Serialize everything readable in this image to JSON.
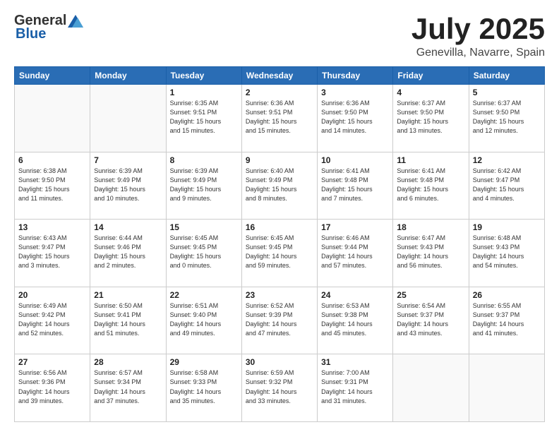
{
  "header": {
    "logo_general": "General",
    "logo_blue": "Blue",
    "month": "July 2025",
    "location": "Genevilla, Navarre, Spain"
  },
  "weekdays": [
    "Sunday",
    "Monday",
    "Tuesday",
    "Wednesday",
    "Thursday",
    "Friday",
    "Saturday"
  ],
  "weeks": [
    [
      {
        "day": "",
        "info": ""
      },
      {
        "day": "",
        "info": ""
      },
      {
        "day": "1",
        "info": "Sunrise: 6:35 AM\nSunset: 9:51 PM\nDaylight: 15 hours\nand 15 minutes."
      },
      {
        "day": "2",
        "info": "Sunrise: 6:36 AM\nSunset: 9:51 PM\nDaylight: 15 hours\nand 15 minutes."
      },
      {
        "day": "3",
        "info": "Sunrise: 6:36 AM\nSunset: 9:50 PM\nDaylight: 15 hours\nand 14 minutes."
      },
      {
        "day": "4",
        "info": "Sunrise: 6:37 AM\nSunset: 9:50 PM\nDaylight: 15 hours\nand 13 minutes."
      },
      {
        "day": "5",
        "info": "Sunrise: 6:37 AM\nSunset: 9:50 PM\nDaylight: 15 hours\nand 12 minutes."
      }
    ],
    [
      {
        "day": "6",
        "info": "Sunrise: 6:38 AM\nSunset: 9:50 PM\nDaylight: 15 hours\nand 11 minutes."
      },
      {
        "day": "7",
        "info": "Sunrise: 6:39 AM\nSunset: 9:49 PM\nDaylight: 15 hours\nand 10 minutes."
      },
      {
        "day": "8",
        "info": "Sunrise: 6:39 AM\nSunset: 9:49 PM\nDaylight: 15 hours\nand 9 minutes."
      },
      {
        "day": "9",
        "info": "Sunrise: 6:40 AM\nSunset: 9:49 PM\nDaylight: 15 hours\nand 8 minutes."
      },
      {
        "day": "10",
        "info": "Sunrise: 6:41 AM\nSunset: 9:48 PM\nDaylight: 15 hours\nand 7 minutes."
      },
      {
        "day": "11",
        "info": "Sunrise: 6:41 AM\nSunset: 9:48 PM\nDaylight: 15 hours\nand 6 minutes."
      },
      {
        "day": "12",
        "info": "Sunrise: 6:42 AM\nSunset: 9:47 PM\nDaylight: 15 hours\nand 4 minutes."
      }
    ],
    [
      {
        "day": "13",
        "info": "Sunrise: 6:43 AM\nSunset: 9:47 PM\nDaylight: 15 hours\nand 3 minutes."
      },
      {
        "day": "14",
        "info": "Sunrise: 6:44 AM\nSunset: 9:46 PM\nDaylight: 15 hours\nand 2 minutes."
      },
      {
        "day": "15",
        "info": "Sunrise: 6:45 AM\nSunset: 9:45 PM\nDaylight: 15 hours\nand 0 minutes."
      },
      {
        "day": "16",
        "info": "Sunrise: 6:45 AM\nSunset: 9:45 PM\nDaylight: 14 hours\nand 59 minutes."
      },
      {
        "day": "17",
        "info": "Sunrise: 6:46 AM\nSunset: 9:44 PM\nDaylight: 14 hours\nand 57 minutes."
      },
      {
        "day": "18",
        "info": "Sunrise: 6:47 AM\nSunset: 9:43 PM\nDaylight: 14 hours\nand 56 minutes."
      },
      {
        "day": "19",
        "info": "Sunrise: 6:48 AM\nSunset: 9:43 PM\nDaylight: 14 hours\nand 54 minutes."
      }
    ],
    [
      {
        "day": "20",
        "info": "Sunrise: 6:49 AM\nSunset: 9:42 PM\nDaylight: 14 hours\nand 52 minutes."
      },
      {
        "day": "21",
        "info": "Sunrise: 6:50 AM\nSunset: 9:41 PM\nDaylight: 14 hours\nand 51 minutes."
      },
      {
        "day": "22",
        "info": "Sunrise: 6:51 AM\nSunset: 9:40 PM\nDaylight: 14 hours\nand 49 minutes."
      },
      {
        "day": "23",
        "info": "Sunrise: 6:52 AM\nSunset: 9:39 PM\nDaylight: 14 hours\nand 47 minutes."
      },
      {
        "day": "24",
        "info": "Sunrise: 6:53 AM\nSunset: 9:38 PM\nDaylight: 14 hours\nand 45 minutes."
      },
      {
        "day": "25",
        "info": "Sunrise: 6:54 AM\nSunset: 9:37 PM\nDaylight: 14 hours\nand 43 minutes."
      },
      {
        "day": "26",
        "info": "Sunrise: 6:55 AM\nSunset: 9:37 PM\nDaylight: 14 hours\nand 41 minutes."
      }
    ],
    [
      {
        "day": "27",
        "info": "Sunrise: 6:56 AM\nSunset: 9:36 PM\nDaylight: 14 hours\nand 39 minutes."
      },
      {
        "day": "28",
        "info": "Sunrise: 6:57 AM\nSunset: 9:34 PM\nDaylight: 14 hours\nand 37 minutes."
      },
      {
        "day": "29",
        "info": "Sunrise: 6:58 AM\nSunset: 9:33 PM\nDaylight: 14 hours\nand 35 minutes."
      },
      {
        "day": "30",
        "info": "Sunrise: 6:59 AM\nSunset: 9:32 PM\nDaylight: 14 hours\nand 33 minutes."
      },
      {
        "day": "31",
        "info": "Sunrise: 7:00 AM\nSunset: 9:31 PM\nDaylight: 14 hours\nand 31 minutes."
      },
      {
        "day": "",
        "info": ""
      },
      {
        "day": "",
        "info": ""
      }
    ]
  ]
}
